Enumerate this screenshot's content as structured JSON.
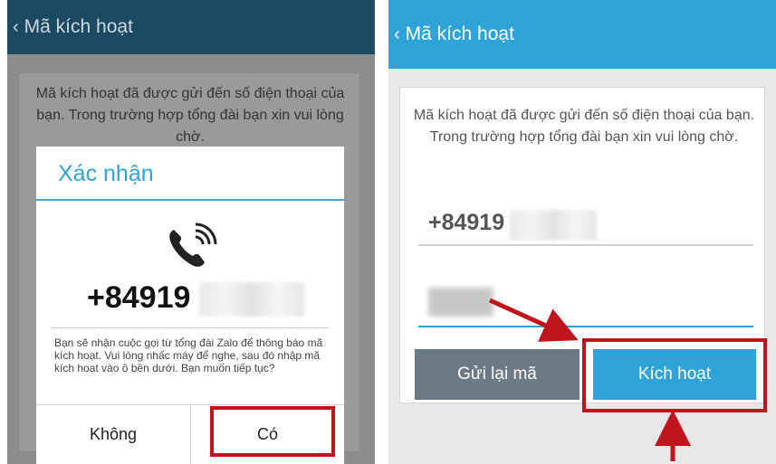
{
  "left": {
    "header_title": "Mã kích hoạt",
    "back_glyph": "‹",
    "message": "Mã kích hoạt đã được gửi đến số điện thoại của bạn. Trong trường hợp tổng đài bạn xin vui lòng chờ.",
    "dialog": {
      "title": "Xác nhận",
      "icon": "phone-ringing-icon",
      "phone_number": "+84919",
      "body": "Bạn sẽ nhận cuộc gọi từ tổng đài Zalo để thông báo mã kích hoạt. Vui lòng nhấc máy để nghe, sau đó nhập mã kích hoạt vào ô bên dưới. Bạn muốn tiếp tục?",
      "no_label": "Không",
      "yes_label": "Có"
    }
  },
  "right": {
    "header_title": "Mã kích hoạt",
    "back_glyph": "‹",
    "message": "Mã kích hoạt đã được gửi đến số điện thoại của bạn. Trong trường hợp tổng đài bạn xin vui lòng chờ.",
    "phone_number": "+84919",
    "resend_label": "Gửi lại mã",
    "activate_label": "Kích hoạt"
  },
  "colors": {
    "accent": "#2ea3d7",
    "highlight": "#c0151d",
    "resend_bg": "#6b7a84",
    "activate_bg": "#2ea3d7"
  }
}
